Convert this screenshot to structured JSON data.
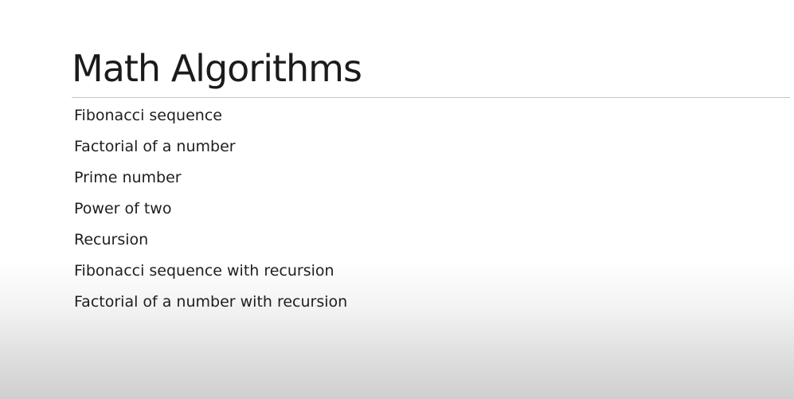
{
  "slide": {
    "title": "Math Algorithms",
    "items": [
      "Fibonacci sequence",
      "Factorial of a number",
      "Prime number",
      "Power of two",
      "Recursion",
      "Fibonacci sequence with recursion",
      "Factorial of a number with recursion"
    ]
  },
  "colors": {
    "text": "#1a1a1a",
    "rule": "#c4c4c4",
    "background_top": "#ffffff",
    "background_bottom": "#cfcfcf"
  }
}
